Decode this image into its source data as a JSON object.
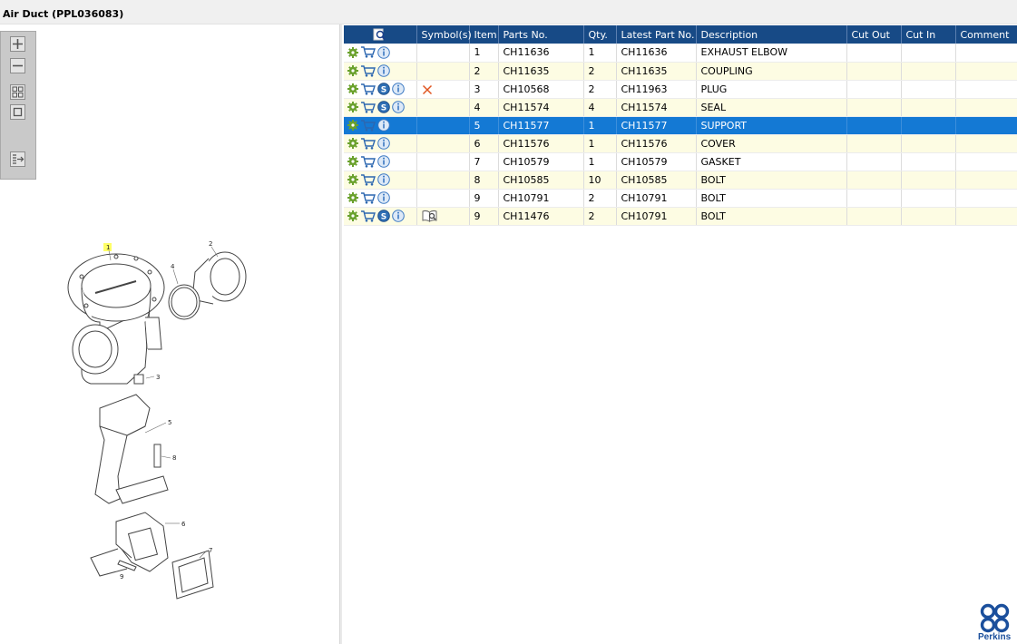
{
  "window": {
    "title": "Air Duct (PPL036083)"
  },
  "toolbar": {
    "buttons": [
      {
        "name": "zoom-in",
        "icon": "zoom-in-icon"
      },
      {
        "name": "zoom-out",
        "icon": "zoom-out-icon"
      },
      {
        "name": "fit-all",
        "icon": "fit-all-icon"
      },
      {
        "name": "fit-window",
        "icon": "fit-window-icon"
      },
      {
        "name": "sync-view",
        "icon": "sync-list-icon"
      }
    ]
  },
  "diagram": {
    "callouts": [
      "1",
      "2",
      "3",
      "4",
      "5",
      "6",
      "7",
      "8",
      "9"
    ]
  },
  "table": {
    "columns": [
      "",
      "Symbol(s)",
      "Item",
      "Parts No.",
      "Qty.",
      "Latest Part No.",
      "Description",
      "Cut Out",
      "Cut In",
      "Comment"
    ],
    "rows": [
      {
        "item": "1",
        "part_no": "CH11636",
        "qty": "1",
        "latest_part_no": "CH11636",
        "description": "EXHAUST ELBOW",
        "cut_out": "",
        "cut_in": "",
        "comment": "",
        "icons": [
          "cog-icon",
          "cart-icon",
          "info-icon"
        ],
        "symbol": "",
        "selected": false
      },
      {
        "item": "2",
        "part_no": "CH11635",
        "qty": "2",
        "latest_part_no": "CH11635",
        "description": "COUPLING",
        "cut_out": "",
        "cut_in": "",
        "comment": "",
        "icons": [
          "cog-icon",
          "cart-icon",
          "info-icon"
        ],
        "symbol": "",
        "selected": false
      },
      {
        "item": "3",
        "part_no": "CH10568",
        "qty": "2",
        "latest_part_no": "CH11963",
        "description": "PLUG",
        "cut_out": "",
        "cut_in": "",
        "comment": "",
        "icons": [
          "cog-icon",
          "cart-icon",
          "supersession-icon",
          "info-icon"
        ],
        "symbol": "cross-icon",
        "selected": false
      },
      {
        "item": "4",
        "part_no": "CH11574",
        "qty": "4",
        "latest_part_no": "CH11574",
        "description": "SEAL",
        "cut_out": "",
        "cut_in": "",
        "comment": "",
        "icons": [
          "cog-icon",
          "cart-icon",
          "supersession-icon",
          "info-icon"
        ],
        "symbol": "",
        "selected": false
      },
      {
        "item": "5",
        "part_no": "CH11577",
        "qty": "1",
        "latest_part_no": "CH11577",
        "description": "SUPPORT",
        "cut_out": "",
        "cut_in": "",
        "comment": "",
        "icons": [
          "cog-icon",
          "cart-icon",
          "info-icon"
        ],
        "symbol": "",
        "selected": true
      },
      {
        "item": "6",
        "part_no": "CH11576",
        "qty": "1",
        "latest_part_no": "CH11576",
        "description": "COVER",
        "cut_out": "",
        "cut_in": "",
        "comment": "",
        "icons": [
          "cog-icon",
          "cart-icon",
          "info-icon"
        ],
        "symbol": "",
        "selected": false
      },
      {
        "item": "7",
        "part_no": "CH10579",
        "qty": "1",
        "latest_part_no": "CH10579",
        "description": "GASKET",
        "cut_out": "",
        "cut_in": "",
        "comment": "",
        "icons": [
          "cog-icon",
          "cart-icon",
          "info-icon"
        ],
        "symbol": "",
        "selected": false
      },
      {
        "item": "8",
        "part_no": "CH10585",
        "qty": "10",
        "latest_part_no": "CH10585",
        "description": "BOLT",
        "cut_out": "",
        "cut_in": "",
        "comment": "",
        "icons": [
          "cog-icon",
          "cart-icon",
          "info-icon"
        ],
        "symbol": "",
        "selected": false
      },
      {
        "item": "9",
        "part_no": "CH10791",
        "qty": "2",
        "latest_part_no": "CH10791",
        "description": "BOLT",
        "cut_out": "",
        "cut_in": "",
        "comment": "",
        "icons": [
          "cog-icon",
          "cart-icon",
          "info-icon"
        ],
        "symbol": "",
        "selected": false
      },
      {
        "item": "9",
        "part_no": "CH11476",
        "qty": "2",
        "latest_part_no": "CH10791",
        "description": "BOLT",
        "cut_out": "",
        "cut_in": "",
        "comment": "",
        "icons": [
          "cog-icon",
          "cart-icon",
          "supersession-icon",
          "info-icon"
        ],
        "symbol": "book-icon",
        "selected": false
      }
    ]
  },
  "header_icon": "magnify-page-icon",
  "brand": {
    "name": "Perkins",
    "color": "#1b4f9c"
  },
  "colors": {
    "header": "#174a86",
    "selected": "#1479d4",
    "stripe": "#fdfce3"
  }
}
